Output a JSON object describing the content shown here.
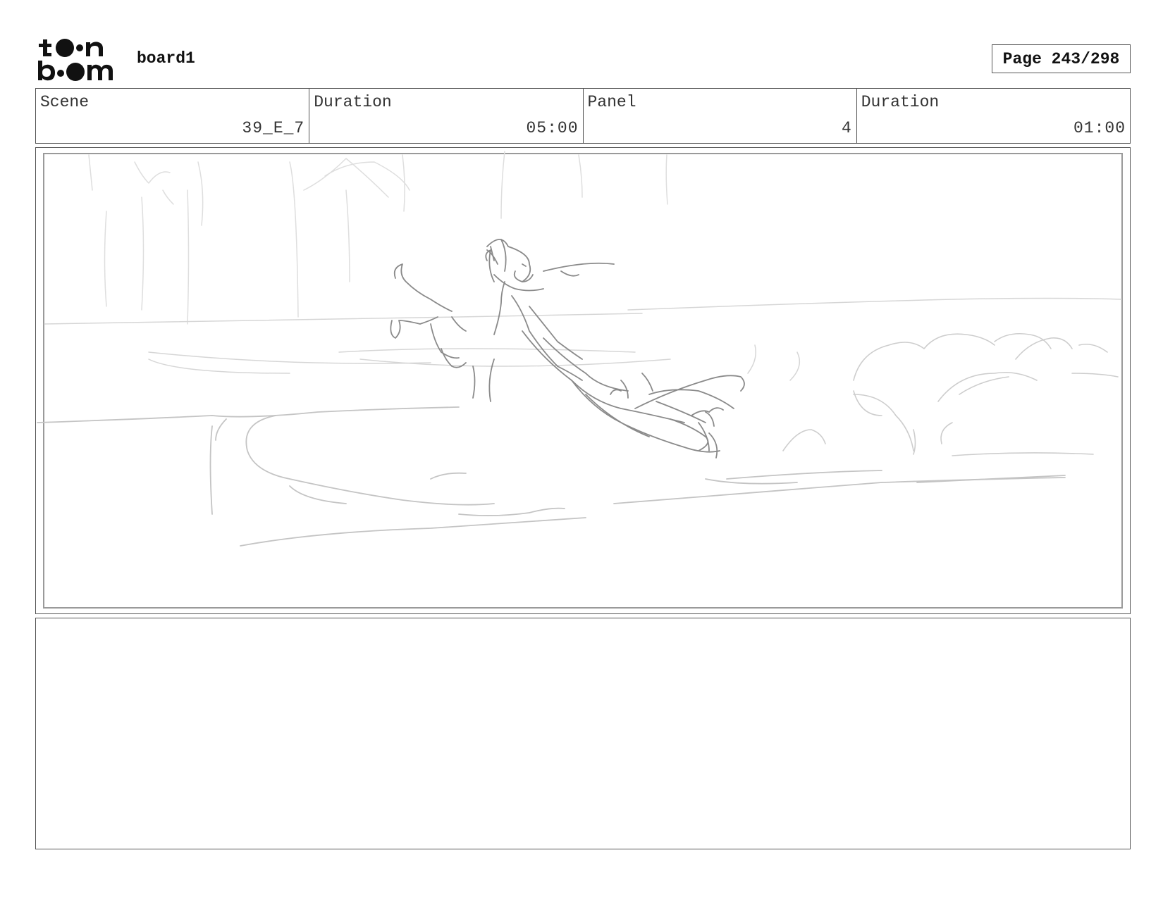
{
  "header": {
    "logo_text_top": "toon",
    "logo_text_bottom": "boom",
    "board_title": "board1",
    "page_label": "Page 243/298"
  },
  "info": {
    "scene_label": "Scene",
    "scene_value": "39_E_7",
    "scene_duration_label": "Duration",
    "scene_duration_value": "05:00",
    "panel_label": "Panel",
    "panel_value": "4",
    "panel_duration_label": "Duration",
    "panel_duration_value": "01:00"
  },
  "notes": {
    "text": ""
  }
}
